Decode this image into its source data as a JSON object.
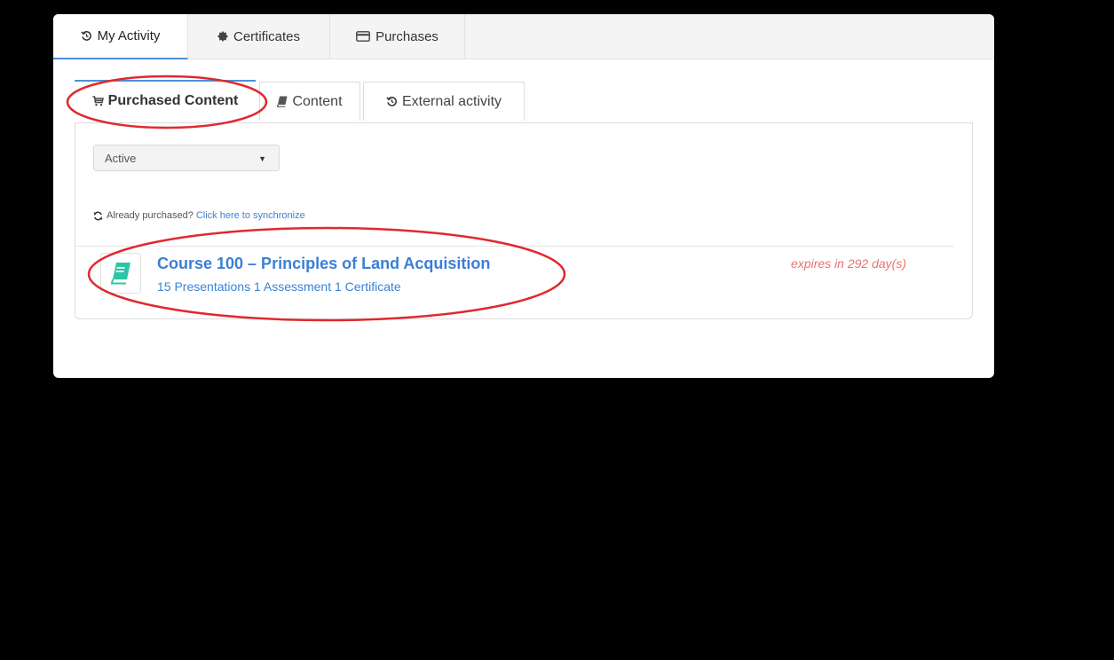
{
  "top_tabs": [
    {
      "label": "My Activity",
      "icon": "history-icon"
    },
    {
      "label": "Certificates",
      "icon": "badge-icon"
    },
    {
      "label": "Purchases",
      "icon": "credit-card-icon"
    }
  ],
  "sub_tabs": [
    {
      "label": "Purchased Content",
      "icon": "cart-icon"
    },
    {
      "label": "Content",
      "icon": "book-icon"
    },
    {
      "label": "External activity",
      "icon": "history-icon"
    }
  ],
  "filter": {
    "selected": "Active"
  },
  "sync": {
    "text": "Already purchased?",
    "link": "Click here to synchronize"
  },
  "course": {
    "title": "Course 100 – Principles of Land Acquisition",
    "meta": "15 Presentations 1 Assessment 1 Certificate",
    "expires": "expires in 292 day(s)"
  },
  "colors": {
    "accent": "#4a90d9",
    "link": "#3b82d6",
    "expires": "#e8736b",
    "book": "#2ec4a6",
    "annotation": "#e0292e"
  }
}
